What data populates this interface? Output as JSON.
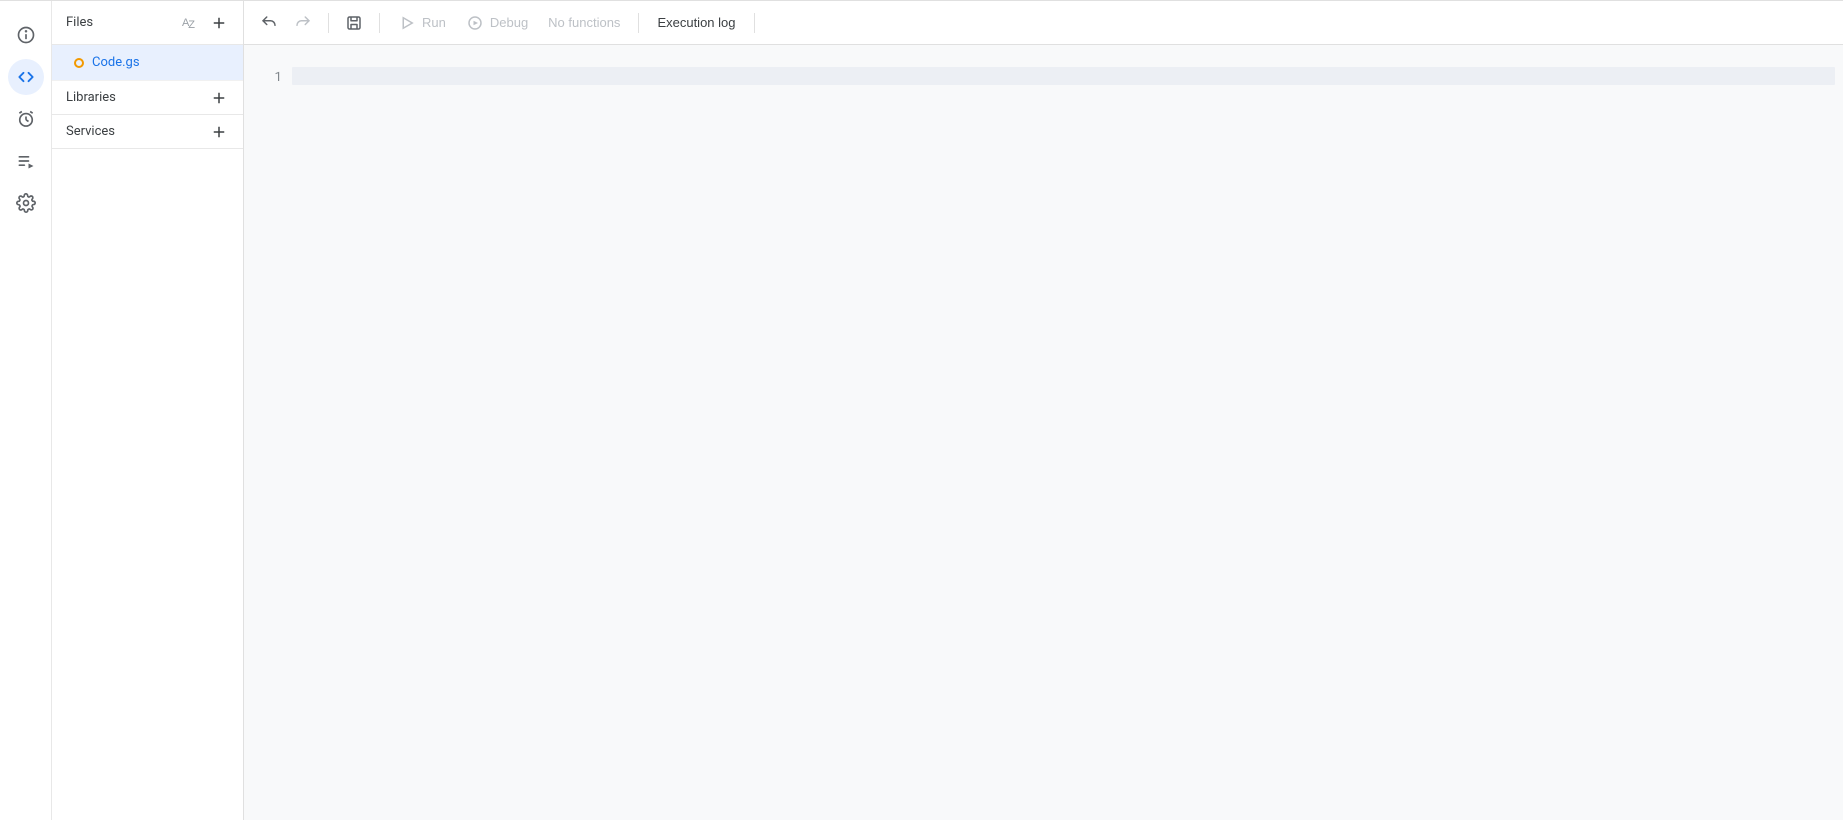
{
  "rail": {
    "items": [
      "overview",
      "editor",
      "triggers",
      "executions",
      "settings"
    ]
  },
  "panel": {
    "files": {
      "title": "Files",
      "items": [
        {
          "name": "Code.gs"
        }
      ]
    },
    "libraries": {
      "title": "Libraries"
    },
    "services": {
      "title": "Services"
    }
  },
  "toolbar": {
    "run": "Run",
    "debug": "Debug",
    "func_selector": "No functions",
    "exec_log": "Execution log"
  },
  "editor": {
    "line_numbers": [
      "1"
    ]
  }
}
